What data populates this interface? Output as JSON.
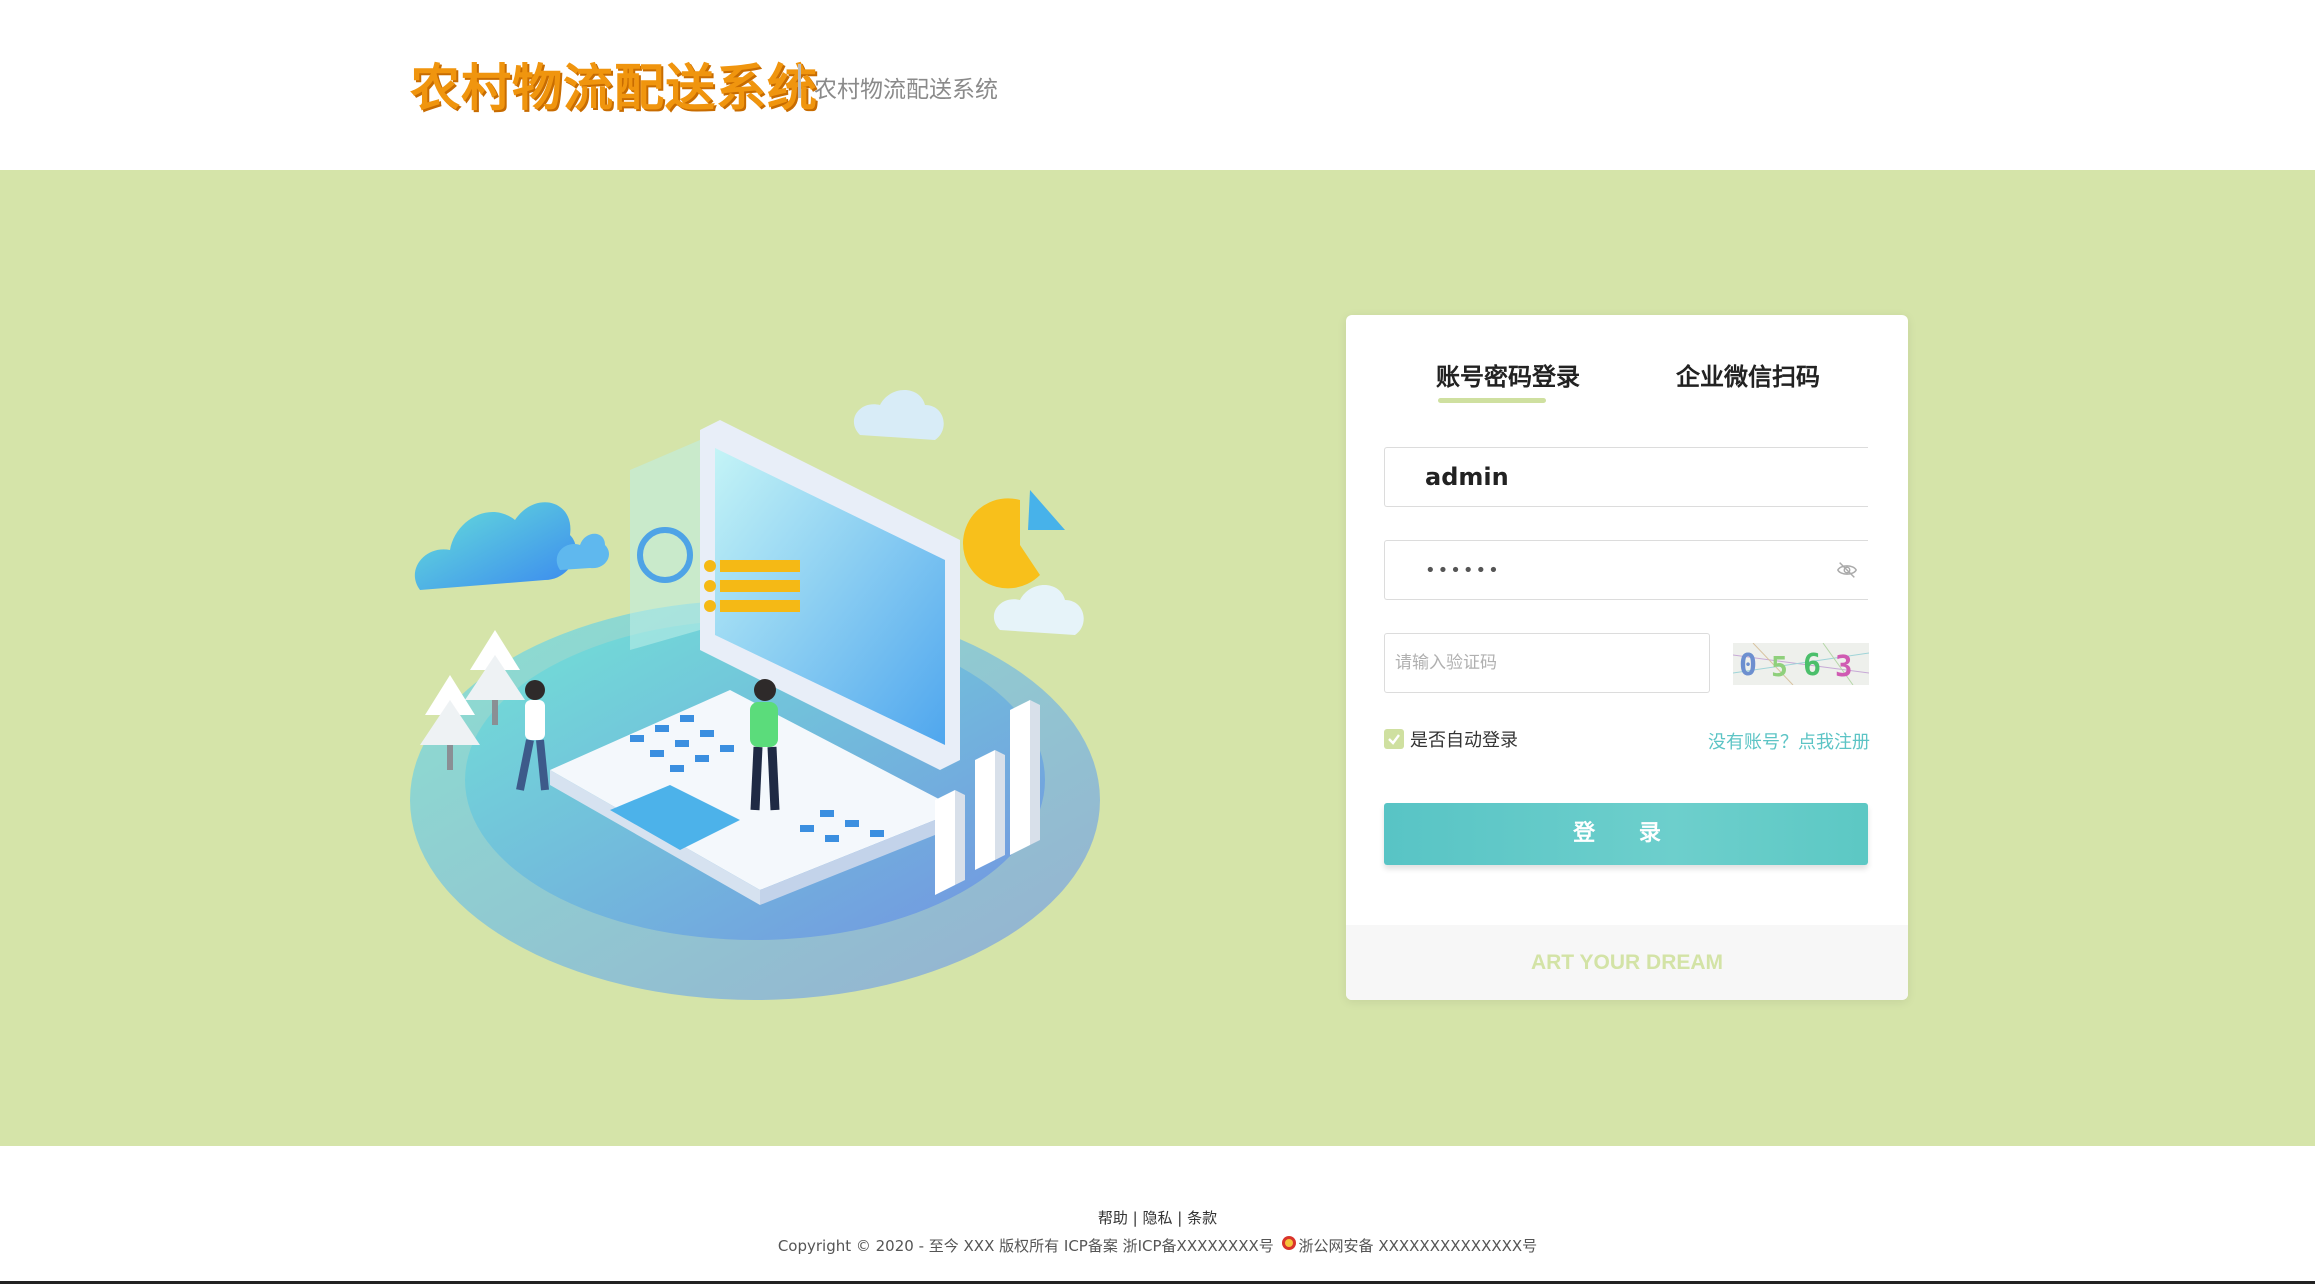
{
  "header": {
    "logo_text": "农村物流配送系统",
    "subtitle": "农村物流配送系统"
  },
  "colors": {
    "band_background": "#d5e4a9",
    "logo": "#f0950e",
    "accent_teal": "#5cc4c5",
    "accent_green": "#cfe0a0"
  },
  "login": {
    "tabs": [
      {
        "label": "账号密码登录",
        "active": true
      },
      {
        "label": "企业微信扫码",
        "active": false
      }
    ],
    "username": {
      "value": "admin"
    },
    "password": {
      "value": "••••••"
    },
    "captcha": {
      "placeholder": "请输入验证码",
      "code": "0563"
    },
    "remember": {
      "label": "是否自动登录",
      "checked": true
    },
    "register_link": "没有账号？点我注册",
    "submit_label": "登 录",
    "footer_slogan": "ART YOUR DREAM"
  },
  "footer": {
    "links": [
      "帮助",
      "隐私",
      "条款"
    ],
    "copyright": "Copyright © 2020 - 至今 XXX 版权所有 ICP备案 浙ICP备XXXXXXXX号",
    "police_record": "浙公网安备 XXXXXXXXXXXXXX号"
  },
  "icons": {
    "password_visibility": "eye-off-icon",
    "checkbox": "check-icon",
    "police_badge": "police-badge-icon"
  }
}
